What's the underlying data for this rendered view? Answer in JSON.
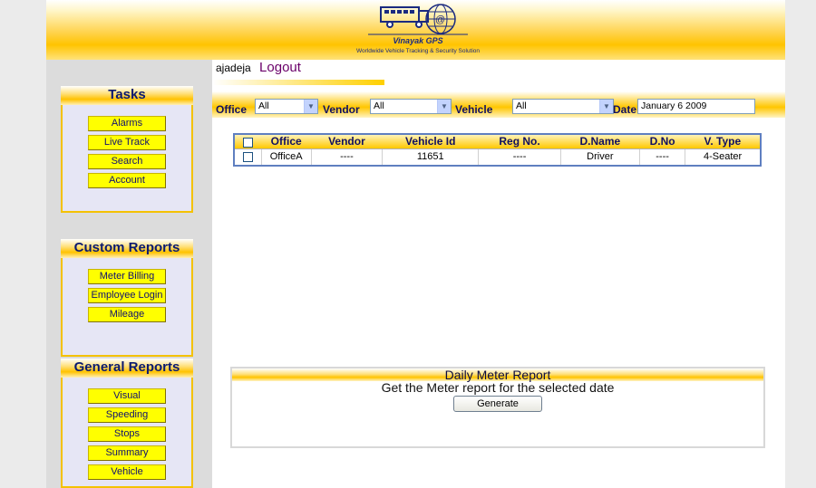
{
  "header": {
    "brand": "Vinayak GPS",
    "tagline": "Worldwide Vehicle Tracking & Security Solution"
  },
  "user": {
    "name": "ajadeja",
    "logout_label": "Logout"
  },
  "sidebar": {
    "tasks": {
      "title": "Tasks",
      "items": [
        "Alarms",
        "Live Track",
        "Search",
        "Account"
      ]
    },
    "custom_reports": {
      "title": "Custom Reports",
      "items": [
        "Meter Billing",
        "Employee Login",
        "Mileage"
      ]
    },
    "general_reports": {
      "title": "General Reports",
      "items": [
        "Visual",
        "Speeding",
        "Stops",
        "Summary",
        "Vehicle"
      ]
    }
  },
  "filters": {
    "office_label": "Office",
    "office_value": "All",
    "vendor_label": "Vendor",
    "vendor_value": "All",
    "vehicle_label": "Vehicle",
    "vehicle_value": "All",
    "date_label": "Date",
    "date_value": "January   6 2009"
  },
  "table": {
    "columns": [
      "Office",
      "Vendor",
      "Vehicle Id",
      "Reg No.",
      "D.Name",
      "D.No",
      "V. Type"
    ],
    "rows": [
      [
        "OfficeA",
        "----",
        "11651",
        "----",
        "Driver",
        "----",
        "4-Seater"
      ]
    ]
  },
  "meter_report": {
    "title": "Daily Meter Report",
    "description": "Get the Meter report for the selected date",
    "button_label": "Generate"
  },
  "colors": {
    "accent_yellow": "#ffc400",
    "button_yellow": "#ffff00",
    "nav_text": "#101070",
    "table_border": "#5f7fc0"
  }
}
